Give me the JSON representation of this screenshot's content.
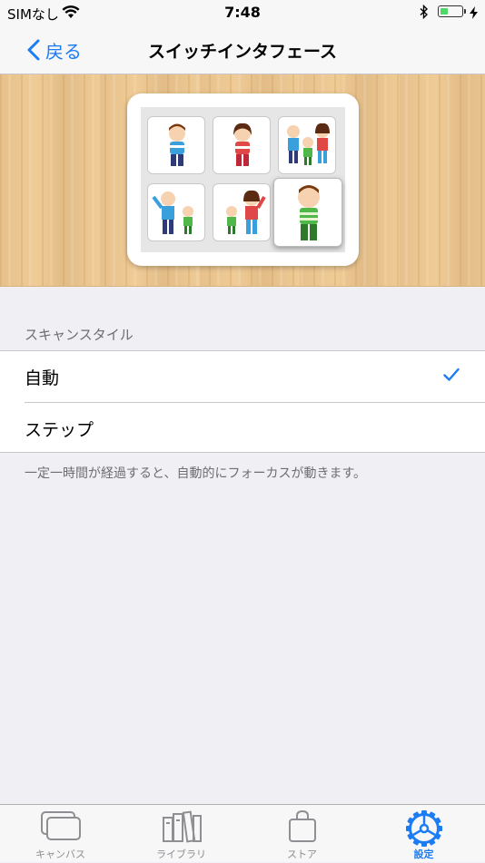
{
  "status_bar": {
    "carrier": "SIMなし",
    "time": "7:48",
    "battery_level": 0.4
  },
  "nav": {
    "back_label": "戻る",
    "title": "スイッチインタフェース"
  },
  "section": {
    "header": "スキャンスタイル",
    "options": [
      {
        "label": "自動",
        "selected": true
      },
      {
        "label": "ステップ",
        "selected": false
      }
    ],
    "footer": "一定一時間が経過すると、自動的にフォーカスが動きます。"
  },
  "tabbar": {
    "tabs": [
      {
        "label": "キャンバス",
        "icon": "canvas-icon",
        "active": false
      },
      {
        "label": "ライブラリ",
        "icon": "library-icon",
        "active": false
      },
      {
        "label": "ストア",
        "icon": "store-bag-icon",
        "active": false
      },
      {
        "label": "設定",
        "icon": "gear-icon",
        "active": true
      }
    ]
  },
  "colors": {
    "accent": "#1b7cf3",
    "background": "#efeff4",
    "wood": "#efcb96"
  }
}
